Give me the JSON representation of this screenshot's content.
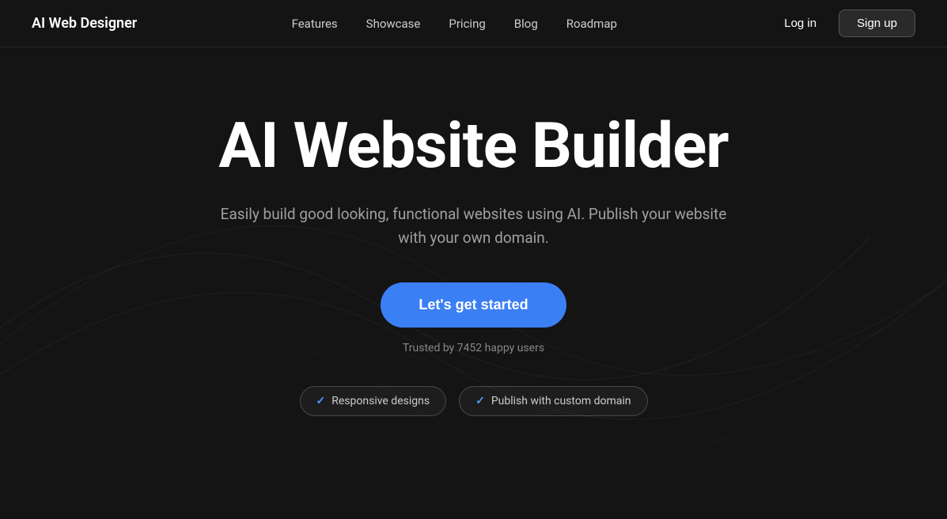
{
  "brand": {
    "logo": "AI Web Designer"
  },
  "nav": {
    "links": [
      {
        "label": "Features",
        "id": "features"
      },
      {
        "label": "Showcase",
        "id": "showcase"
      },
      {
        "label": "Pricing",
        "id": "pricing"
      },
      {
        "label": "Blog",
        "id": "blog"
      },
      {
        "label": "Roadmap",
        "id": "roadmap"
      }
    ],
    "login": "Log in",
    "signup": "Sign up"
  },
  "hero": {
    "title": "AI Website Builder",
    "subtitle": "Easily build good looking, functional websites using AI. Publish your website with your own domain.",
    "cta": "Let's get started",
    "trusted": "Trusted by 7452 happy users"
  },
  "badges": [
    {
      "icon": "✓",
      "label": "Responsive designs"
    },
    {
      "icon": "✓",
      "label": "Publish with custom domain"
    }
  ]
}
